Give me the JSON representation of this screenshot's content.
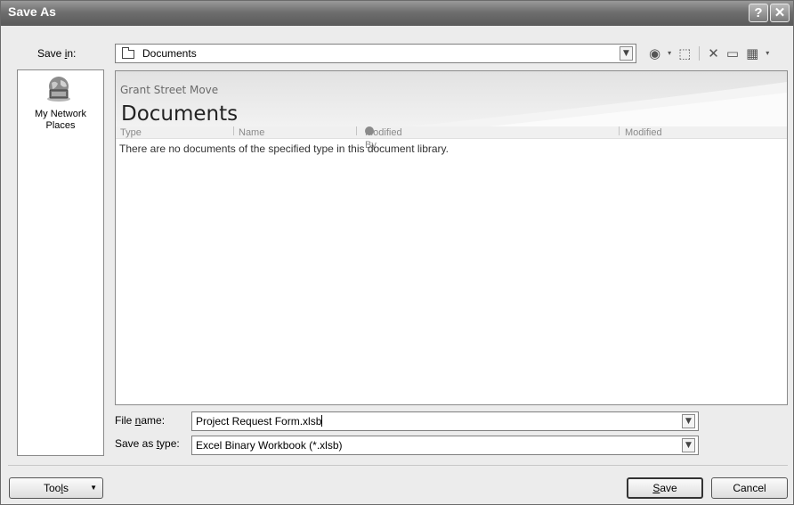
{
  "window": {
    "title": "Save As",
    "help_glyph": "?",
    "close_glyph": "✕"
  },
  "save_in": {
    "label": "Save in:",
    "value": "Documents",
    "arrow": "⌄"
  },
  "toolbar": {
    "back_glyph": "◉",
    "back_dropdown": "▾",
    "up_glyph": "⬚",
    "delete_glyph": "✕",
    "new_folder_glyph": "▭",
    "views_glyph": "▦",
    "views_dropdown": "▾"
  },
  "places": [
    {
      "label": "My Network Places"
    }
  ],
  "library": {
    "site_name": "Grant Street Move",
    "title": "Documents",
    "columns": [
      "Type",
      "Name",
      "Modified By",
      "Modified"
    ],
    "empty_message": "There are no documents of the specified type in this document library."
  },
  "file_name": {
    "label": "File name:",
    "value": "Project Request Form.xlsb"
  },
  "file_type": {
    "label": "Save as type:",
    "value": "Excel Binary Workbook (*.xlsb)"
  },
  "buttons": {
    "tools": "Tools",
    "save": "Save",
    "cancel": "Cancel"
  }
}
